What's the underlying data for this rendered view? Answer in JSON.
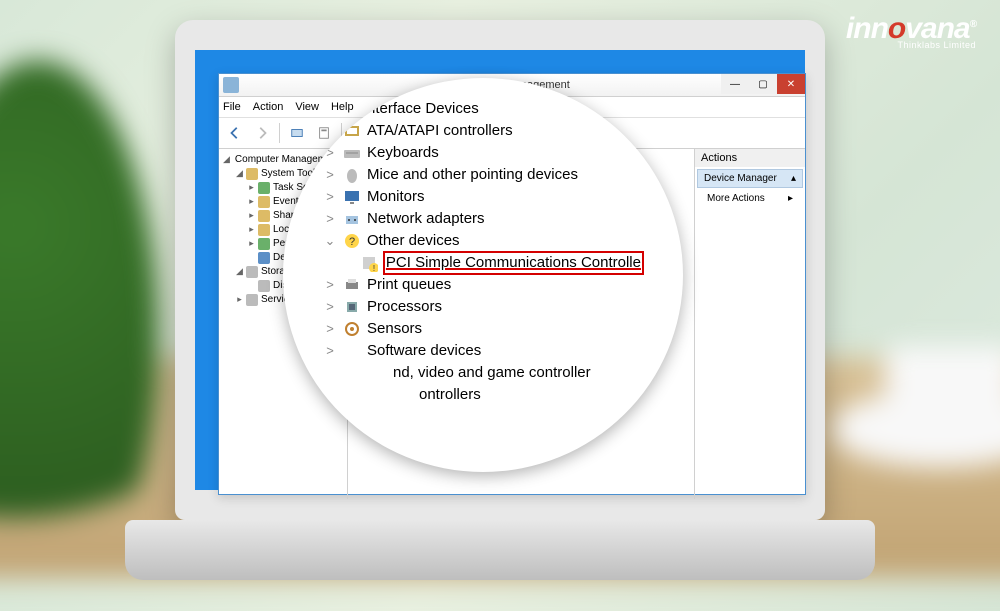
{
  "brand": {
    "text_a": "inn",
    "text_b": "o",
    "text_c": "vana",
    "tag": "Thinklabs Limited",
    "reg": "®"
  },
  "window": {
    "title": "Computer Management",
    "menus": [
      "File",
      "Action",
      "View",
      "Help"
    ]
  },
  "tree": {
    "root": "Computer Management (Local",
    "groups": [
      {
        "label": "System Tools",
        "children": [
          "Task Scheduler",
          "Event Viewer",
          "Shared Folde",
          "Local Users",
          "Performa",
          "Device M"
        ]
      },
      {
        "label": "Storage",
        "children": [
          "Disk M"
        ]
      },
      {
        "label": "Services"
      }
    ]
  },
  "actions": {
    "header": "Actions",
    "sub": "Device Manager",
    "more": "More Actions"
  },
  "devices": [
    {
      "icon": "hid",
      "label": "nterface Devices",
      "toggle": ">"
    },
    {
      "icon": "ata",
      "label": "ATA/ATAPI controllers",
      "toggle": ">"
    },
    {
      "icon": "kbd",
      "label": "Keyboards",
      "toggle": ">"
    },
    {
      "icon": "mouse",
      "label": "Mice and other pointing devices",
      "toggle": ">"
    },
    {
      "icon": "mon",
      "label": "Monitors",
      "toggle": ">"
    },
    {
      "icon": "net",
      "label": "Network adapters",
      "toggle": ">"
    },
    {
      "icon": "warn",
      "label": "Other devices",
      "toggle": "⌄"
    },
    {
      "icon": "warndev",
      "label": "PCI Simple Communications Controlle",
      "sub": true,
      "hl": true
    },
    {
      "icon": "print",
      "label": "Print queues",
      "toggle": ">"
    },
    {
      "icon": "cpu",
      "label": "Processors",
      "toggle": ">"
    },
    {
      "icon": "sensor",
      "label": "Sensors",
      "toggle": ">"
    },
    {
      "icon": "",
      "label": "Software devices",
      "toggle": ">"
    },
    {
      "icon": "",
      "label": "nd, video and game controller",
      "toggle": "",
      "fade": true
    },
    {
      "icon": "",
      "label": "ontrollers",
      "toggle": "",
      "fade2": true
    }
  ]
}
